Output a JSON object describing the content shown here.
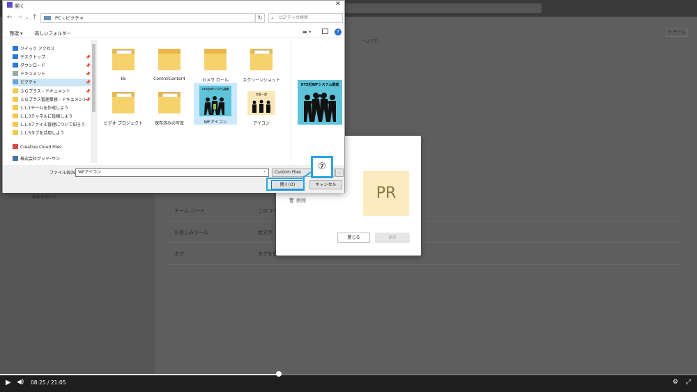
{
  "background": {
    "team_button": "+ チーム",
    "rows": [
      {
        "label": "チーム コード",
        "value": "このコード"
      },
      {
        "label": "お楽しみツール",
        "value": "絵文字"
      },
      {
        "label": "タグ",
        "value": "タグを管"
      }
    ],
    "partial_text": "ームです。",
    "left_partial": "検索を他のデ"
  },
  "team_dialog": {
    "avatar_text": "PR",
    "delete_label": "削除",
    "close_label": "閉じる",
    "save_label": "保存"
  },
  "file_dialog": {
    "title": "開く",
    "address": "PC  ›  ピクチャ",
    "search_placeholder": "ピクチャの検索",
    "organize": "整理 ▾",
    "new_folder": "新しいフォルダー",
    "tree": [
      {
        "label": "クイック アクセス",
        "icon": "star-icon",
        "pinned": false
      },
      {
        "label": "デスクトップ",
        "icon": "desktop-icon",
        "pinned": true
      },
      {
        "label": "ダウンロード",
        "icon": "download-icon",
        "pinned": true
      },
      {
        "label": "ドキュメント",
        "icon": "document-icon",
        "pinned": true
      },
      {
        "label": "ピクチャ",
        "icon": "pictures-icon",
        "pinned": true
      },
      {
        "label": "ＳＧプラス - ドキュメント",
        "icon": "folder-icon",
        "pinned": true
      },
      {
        "label": "ＳＧプラス管理業務 - ドキュメント",
        "icon": "folder-icon",
        "pinned": true
      },
      {
        "label": "1.1.1チームを作成しよう",
        "icon": "folder-icon",
        "pinned": false
      },
      {
        "label": "1.1.3チャネルに投稿しよう",
        "icon": "folder-icon",
        "pinned": false
      },
      {
        "label": "1.1.4ファイル管理について知ろう",
        "icon": "folder-icon",
        "pinned": false
      },
      {
        "label": "1.1.5タブを活用しよう",
        "icon": "folder-icon",
        "pinned": false
      },
      {
        "label": "Creative Cloud Files",
        "icon": "cloud-icon",
        "pinned": false
      },
      {
        "label": "株式会社グッド･サン",
        "icon": "building-icon",
        "pinned": false
      }
    ],
    "files": [
      {
        "name": "bk",
        "kind": "folder-docs"
      },
      {
        "name": "ControlCenter4",
        "kind": "folder"
      },
      {
        "name": "カメラ ロール",
        "kind": "folder"
      },
      {
        "name": "スクリーンショット",
        "kind": "folder-docs"
      },
      {
        "name": "ビデオ プロジェクト",
        "kind": "folder-docs"
      },
      {
        "name": "保存済みの写真",
        "kind": "folder-docs"
      },
      {
        "name": "WFアイコン",
        "kind": "image-wf"
      },
      {
        "name": "アイコン",
        "kind": "image-team"
      }
    ],
    "wf_thumb_text": "XYZ社WFシステム提案",
    "team_thumb_text": "営業一課",
    "preview_text": "XYZ社WFシステム提案",
    "filename_label": "ファイル名(N):",
    "filename_value": "WFアイコン",
    "filetype": "Custom Files",
    "open_label": "開く(O)",
    "cancel_label": "キャンセル"
  },
  "callout_number": "⑦",
  "player": {
    "time": "08:25  /  21:05",
    "progress": 0.4
  },
  "colors": {
    "highlight": "#2aa6de",
    "folder": "#f6d26c",
    "selection": "#cce8ff"
  }
}
